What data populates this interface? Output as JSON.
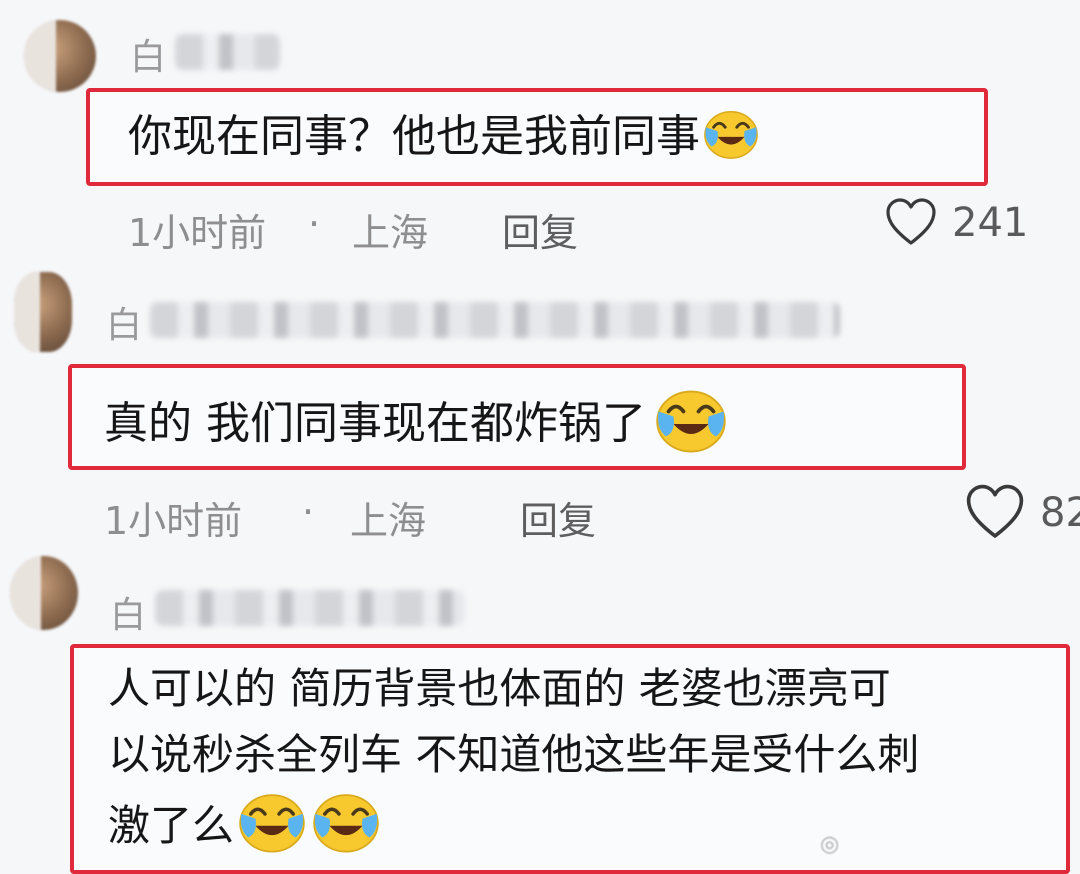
{
  "comments": [
    {
      "username": "白",
      "text": "你现在同事？他也是我前同事",
      "time": "1小时前",
      "location": "上海",
      "reply_label": "回复",
      "likes": "241",
      "emoji": "laugh-cry-emoji"
    },
    {
      "username": "白",
      "text": "真的 我们同事现在都炸锅了",
      "time": "1小时前",
      "location": "上海",
      "reply_label": "回复",
      "likes": "82",
      "emoji": "laugh-cry-emoji"
    },
    {
      "username": "白",
      "text_line1": "人可以的 简历背景也体面的 老婆也漂亮可",
      "text_line2": "以说秒杀全列车 不知道他这些年是受什么刺",
      "text_line3": "激了么",
      "emoji": "laugh-cry-emoji"
    }
  ],
  "meta_separator": "·",
  "icons": {
    "like": "heart-outline-icon",
    "emoji": "laugh-cry-emoji"
  },
  "colors": {
    "highlight_border": "#e0293a",
    "meta_text": "#8e8e8e",
    "emoji_yellow": "#f7c92e",
    "emoji_tear": "#5ab4f0"
  }
}
